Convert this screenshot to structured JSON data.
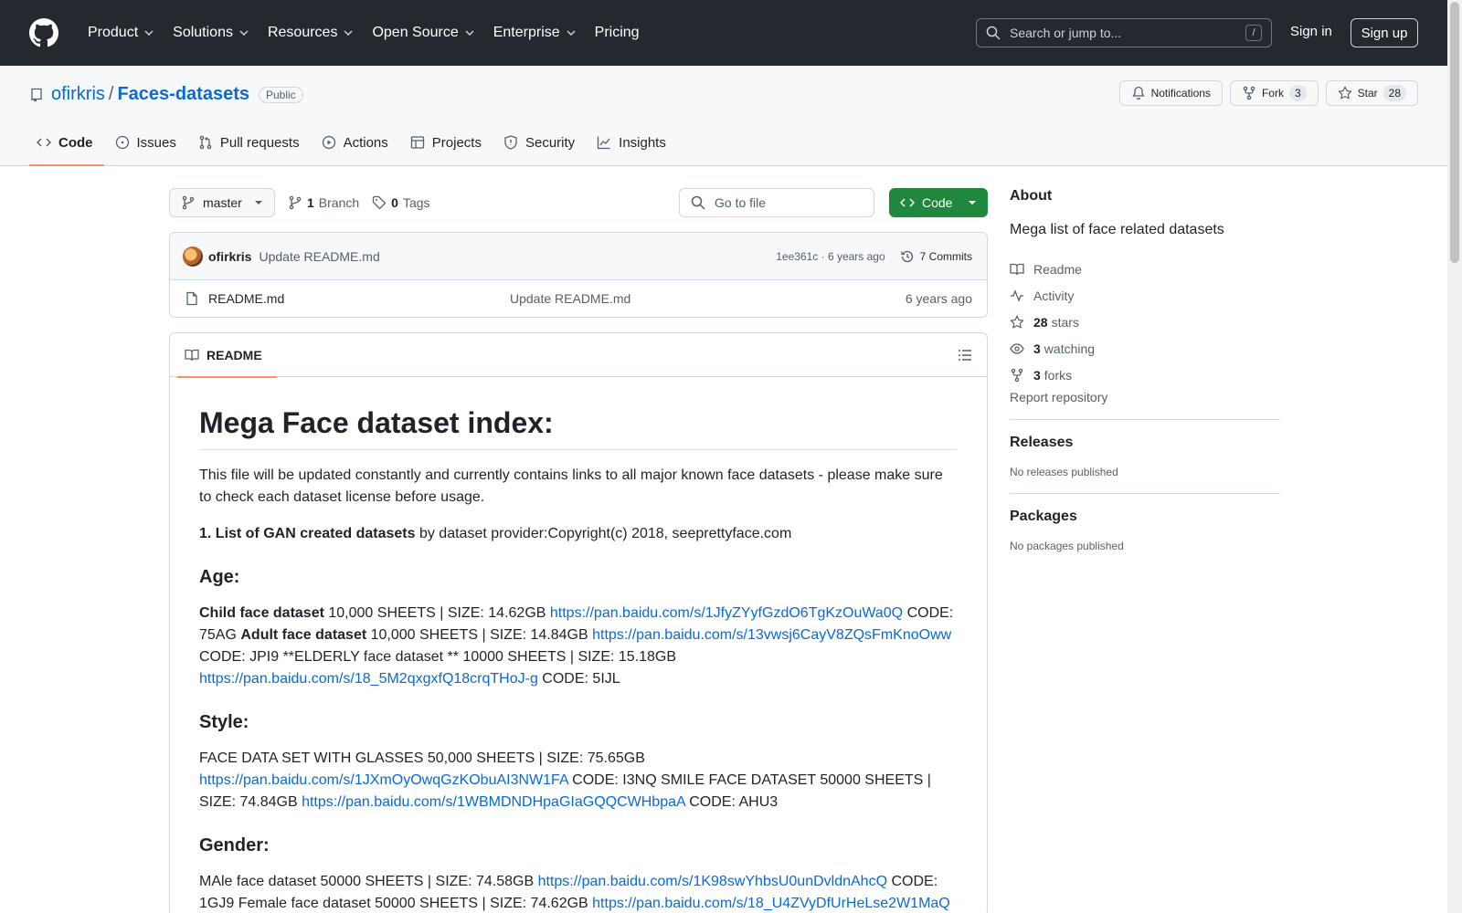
{
  "topnav": {
    "items": [
      "Product",
      "Solutions",
      "Resources",
      "Open Source",
      "Enterprise",
      "Pricing"
    ],
    "search_placeholder": "Search or jump to...",
    "search_key": "/",
    "signin": "Sign in",
    "signup": "Sign up"
  },
  "repo": {
    "owner": "ofirkris",
    "separator": "/",
    "name": "Faces-datasets",
    "visibility": "Public",
    "notifications": "Notifications",
    "fork_label": "Fork",
    "fork_count": "3",
    "star_label": "Star",
    "star_count": "28",
    "tabs": [
      "Code",
      "Issues",
      "Pull requests",
      "Actions",
      "Projects",
      "Security",
      "Insights"
    ]
  },
  "toolbar": {
    "branch": "master",
    "branch_count": "1",
    "branch_label": "Branch",
    "tag_count": "0",
    "tag_label": "Tags",
    "goto_placeholder": "Go to file",
    "code_button": "Code"
  },
  "commit": {
    "author": "ofirkris",
    "message": "Update README.md",
    "hash_time": "1ee361c · 6 years ago",
    "commits": "7 Commits"
  },
  "files": [
    {
      "name": "README.md",
      "message": "Update README.md",
      "date": "6 years ago"
    }
  ],
  "readme": {
    "tab": "README",
    "h1": "Mega Face dataset index:",
    "intro": "This file will be updated constantly and currently contains links to all major known face datasets - please make sure to check each dataset license before usage.",
    "list_bold": "1. List of GAN created datasets",
    "list_rest": " by dataset provider:Copyright(c) 2018, seeprettyface.com",
    "age_h": "Age:",
    "age": {
      "child_b": "Child face dataset",
      "child_t": " 10,000 SHEETS | SIZE: 14.62GB ",
      "child_link": "https://pan.baidu.com/s/1JfyZYyfGzdO6TgKzOuWa0Q",
      "child_code": " CODE: 75AG ",
      "adult_b": "Adult face dataset",
      "adult_t": " 10,000 SHEETS | SIZE: 14.84GB ",
      "adult_link": "https://pan.baidu.com/s/13vwsj6CayV8ZQsFmKnoOww",
      "adult_code": " CODE: JPI9 **ELDERLY face dataset ** 10000 SHEETS | SIZE: 15.18GB ",
      "elderly_link": "https://pan.baidu.com/s/18_5M2qxgxfQ18crqTHoJ-g",
      "elderly_code": " CODE: 5IJL"
    },
    "style_h": "Style:",
    "style": {
      "t1": "FACE DATA SET WITH GLASSES 50,000 SHEETS | SIZE: 75.65GB ",
      "link1": "https://pan.baidu.com/s/1JXmOyOwqGzKObuAI3NW1FA",
      "t2": " CODE: I3NQ SMILE FACE DATASET 50000 SHEETS | SIZE: 74.84GB ",
      "link2": "https://pan.baidu.com/s/1WBMDNDHpaGIaGQQCWHbpaA",
      "t3": " CODE: AHU3"
    },
    "gender_h": "Gender:",
    "gender": {
      "t1": "MAle face dataset 50000 SHEETS | SIZE: 74.58GB ",
      "link1": "https://pan.baidu.com/s/1K98swYhbsU0unDvldnAhcQ",
      "t2": " CODE: 1GJ9 Female face dataset 50000 SHEETS | SIZE: 74.62GB ",
      "link2": "https://pan.baidu.com/s/18_U4ZVyDfUrHeLse2W1MaQ"
    }
  },
  "sidebar": {
    "about_title": "About",
    "description": "Mega list of face related datasets",
    "readme": "Readme",
    "activity": "Activity",
    "stars_count": "28",
    "stars_label": "stars",
    "watching_count": "3",
    "watching_label": "watching",
    "forks_count": "3",
    "forks_label": "forks",
    "report": "Report repository",
    "releases_title": "Releases",
    "releases_empty": "No releases published",
    "packages_title": "Packages",
    "packages_empty": "No packages published"
  },
  "colors": {
    "header_bg": "#24292f",
    "link": "#0969da",
    "code_button": "#1f883d",
    "active_tab_underline": "#fd8c73"
  }
}
